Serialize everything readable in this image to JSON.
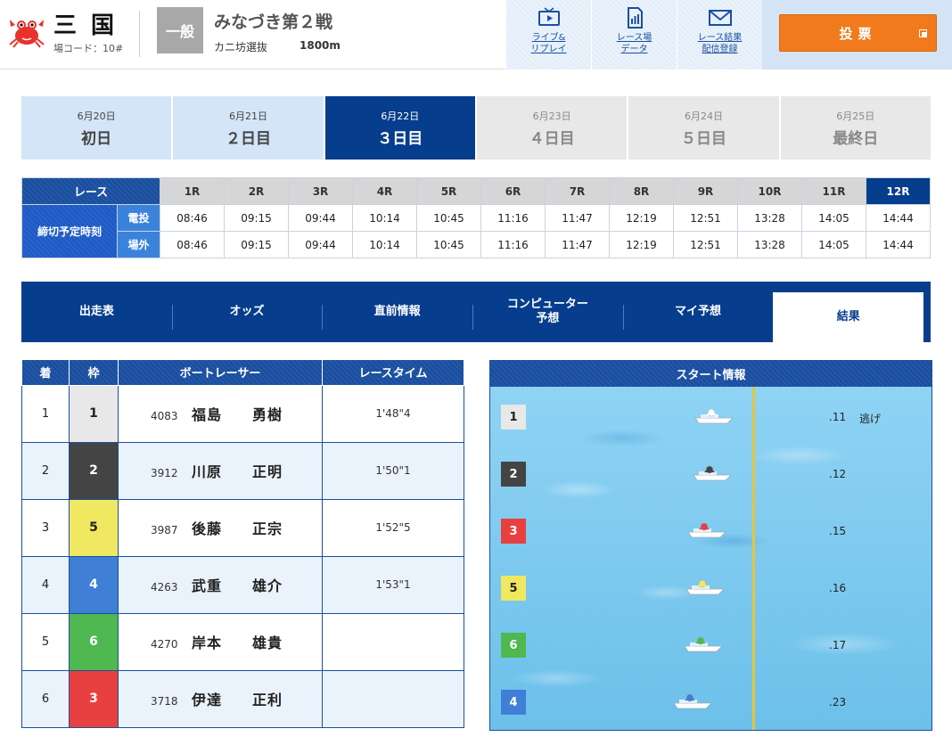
{
  "header": {
    "venue_name": "三国",
    "venue_code": "場コード：10#",
    "grade": "一般",
    "race_title": "みなづき第２戦",
    "race_sub": "カニ坊選抜",
    "distance": "1800m",
    "links": [
      {
        "label": "ライブ&\nリプレイ",
        "icon": "tv-icon"
      },
      {
        "label": "レース場\nデータ",
        "icon": "document-icon"
      },
      {
        "label": "レース結果\n配信登録",
        "icon": "mail-icon"
      }
    ],
    "vote_label": "投票"
  },
  "days": [
    {
      "date": "6月20日",
      "label": "初日",
      "state": "done"
    },
    {
      "date": "6月21日",
      "label": "２日目",
      "state": "done"
    },
    {
      "date": "6月22日",
      "label": "３日目",
      "state": "active"
    },
    {
      "date": "6月23日",
      "label": "４日目",
      "state": "future"
    },
    {
      "date": "6月24日",
      "label": "５日目",
      "state": "future"
    },
    {
      "date": "6月25日",
      "label": "最終日",
      "state": "future"
    }
  ],
  "deadline": {
    "race_header": "レース",
    "row_label": "締切予定時刻",
    "sub_labels": [
      "電投",
      "場外"
    ],
    "races": [
      "1R",
      "2R",
      "3R",
      "4R",
      "5R",
      "6R",
      "7R",
      "8R",
      "9R",
      "10R",
      "11R",
      "12R"
    ],
    "current_race": "12R",
    "denpyo": [
      "08:46",
      "09:15",
      "09:44",
      "10:14",
      "10:45",
      "11:16",
      "11:47",
      "12:19",
      "12:51",
      "13:28",
      "14:05",
      "14:44"
    ],
    "jougai": [
      "08:46",
      "09:15",
      "09:44",
      "10:14",
      "10:45",
      "11:16",
      "11:47",
      "12:19",
      "12:51",
      "13:28",
      "14:05",
      "14:44"
    ]
  },
  "section_tabs": [
    {
      "label": "出走表",
      "active": false
    },
    {
      "label": "オッズ",
      "active": false
    },
    {
      "label": "直前情報",
      "active": false
    },
    {
      "label": "コンピューター\n予想",
      "active": false
    },
    {
      "label": "マイ予想",
      "active": false
    },
    {
      "label": "結果",
      "active": true
    }
  ],
  "result": {
    "headers": [
      "着",
      "枠",
      "ボートレーサー",
      "レースタイム"
    ],
    "rows": [
      {
        "rank": "1",
        "waku": "1",
        "number": "4083",
        "name": "福島　　勇樹",
        "time": "1'48\"4"
      },
      {
        "rank": "2",
        "waku": "2",
        "number": "3912",
        "name": "川原　　正明",
        "time": "1'50\"1"
      },
      {
        "rank": "3",
        "waku": "5",
        "number": "3987",
        "name": "後藤　　正宗",
        "time": "1'52\"5"
      },
      {
        "rank": "4",
        "waku": "4",
        "number": "4263",
        "name": "武重　　雄介",
        "time": "1'53\"1"
      },
      {
        "rank": "5",
        "waku": "6",
        "number": "4270",
        "name": "岸本　　雄貴",
        "time": ""
      },
      {
        "rank": "6",
        "waku": "3",
        "number": "3718",
        "name": "伊達　　正利",
        "time": ""
      }
    ]
  },
  "start_info": {
    "title": "スタート情報",
    "rows": [
      {
        "waku": "1",
        "st": ".11",
        "note": "逃げ"
      },
      {
        "waku": "2",
        "st": ".12",
        "note": ""
      },
      {
        "waku": "3",
        "st": ".15",
        "note": ""
      },
      {
        "waku": "5",
        "st": ".16",
        "note": ""
      },
      {
        "waku": "6",
        "st": ".17",
        "note": ""
      },
      {
        "waku": "4",
        "st": ".23",
        "note": ""
      }
    ]
  },
  "waku_colors": {
    "1": {
      "bg": "#e8e8e8",
      "fg": "#222222"
    },
    "2": {
      "bg": "#444444",
      "fg": "#ffffff"
    },
    "3": {
      "bg": "#e84040",
      "fg": "#ffffff"
    },
    "4": {
      "bg": "#3f7fd6",
      "fg": "#ffffff"
    },
    "5": {
      "bg": "#f0e860",
      "fg": "#222222"
    },
    "6": {
      "bg": "#4fb850",
      "fg": "#ffffff"
    }
  }
}
